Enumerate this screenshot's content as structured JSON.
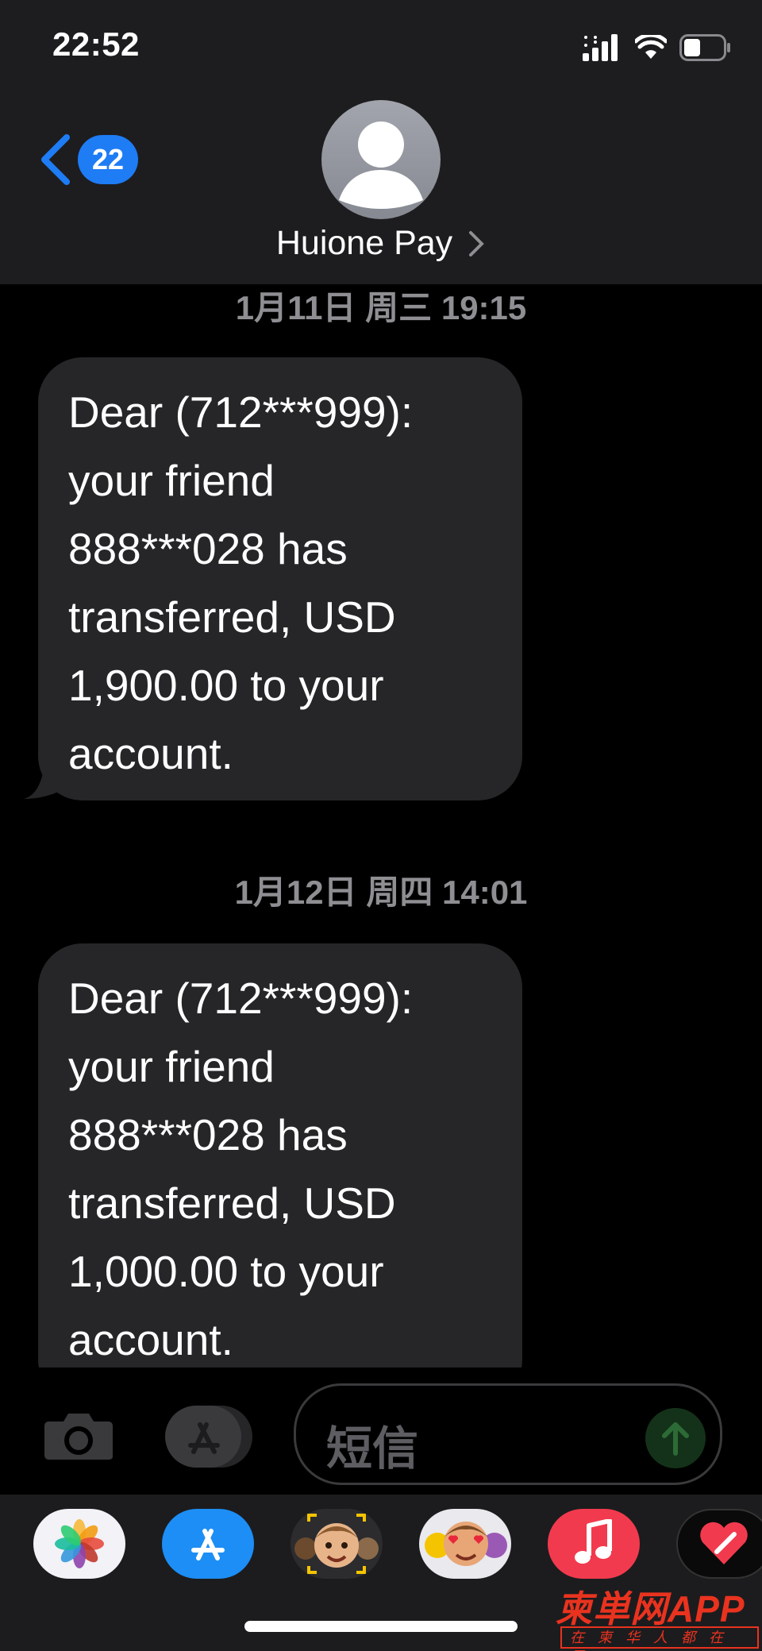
{
  "status_bar": {
    "time": "22:52"
  },
  "nav": {
    "back_count": "22",
    "contact_name": "Huione Pay"
  },
  "messages": [
    {
      "timestamp": "1月11日 周三 19:15",
      "lines": [
        "Dear (712***999):",
        "your friend",
        "888***028 has",
        "transferred, USD",
        "1,900.00 to your",
        "account."
      ]
    },
    {
      "timestamp": "1月12日 周四 14:01",
      "lines": [
        "Dear (712***999):",
        "your friend",
        "888***028 has",
        "transferred, USD",
        "1,000.00 to your",
        "account."
      ]
    }
  ],
  "input": {
    "placeholder": "短信"
  },
  "app_drawer": [
    "photos-app",
    "app-store-app",
    "memoji-stickers-app",
    "animoji-app",
    "music-app",
    "digital-touch-app"
  ],
  "watermark": {
    "main": "柬単网APP",
    "sub": "在柬华人都在用"
  },
  "colors": {
    "accent": "#1e7cf5",
    "bubble": "#262628",
    "header": "#1d1d1f"
  }
}
